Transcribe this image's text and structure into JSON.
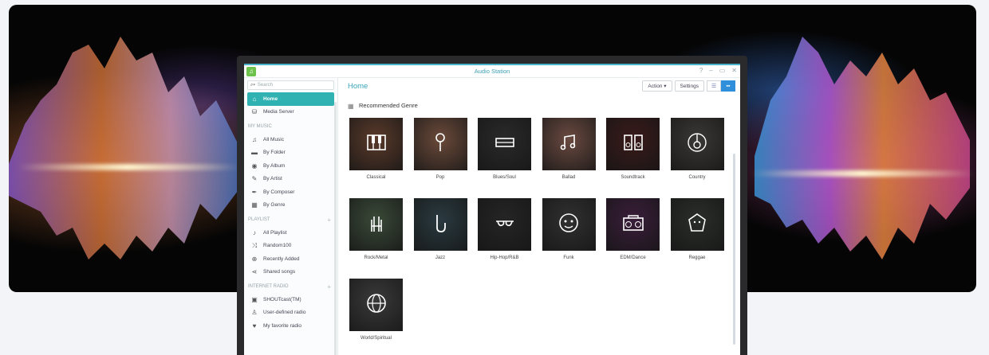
{
  "window": {
    "title": "Audio Station",
    "controls": [
      "?",
      "–",
      "▭",
      "✕"
    ]
  },
  "search": {
    "placeholder": "Search"
  },
  "sidebar": {
    "top_items": [
      {
        "label": "Home",
        "icon": "home-icon",
        "active": true
      },
      {
        "label": "Media Server",
        "icon": "media-server-icon",
        "active": false
      }
    ],
    "my_music": {
      "heading": "MY MUSIC",
      "items": [
        {
          "label": "All Music",
          "icon": "music-note-icon"
        },
        {
          "label": "By Folder",
          "icon": "folder-icon"
        },
        {
          "label": "By Album",
          "icon": "album-icon"
        },
        {
          "label": "By Artist",
          "icon": "microphone-icon"
        },
        {
          "label": "By Composer",
          "icon": "pen-icon"
        },
        {
          "label": "By Genre",
          "icon": "genre-grid-icon"
        }
      ]
    },
    "playlist": {
      "heading": "PLAYLIST",
      "items": [
        {
          "label": "All Playlist",
          "icon": "playlist-icon"
        },
        {
          "label": "Random100",
          "icon": "shuffle-icon"
        },
        {
          "label": "Recently Added",
          "icon": "plus-circle-icon"
        },
        {
          "label": "Shared songs",
          "icon": "share-icon"
        }
      ]
    },
    "internet_radio": {
      "heading": "INTERNET RADIO",
      "items": [
        {
          "label": "SHOUTcast(TM)",
          "icon": "radio-icon"
        },
        {
          "label": "User-defined radio",
          "icon": "user-icon"
        },
        {
          "label": "My favorite radio",
          "icon": "heart-icon"
        }
      ]
    }
  },
  "main": {
    "title": "Home",
    "toolbar": {
      "action_label": "Action ▾",
      "settings_label": "Settings"
    },
    "section_title": "Recommended Genre",
    "genres": [
      {
        "label": "Classical",
        "icon": "piano-keys-icon",
        "color": "#5a3a2a"
      },
      {
        "label": "Pop",
        "icon": "microphone-icon",
        "color": "#6b4a3a"
      },
      {
        "label": "Blues/Soul",
        "icon": "harmonica-icon",
        "color": "#2a2a2a"
      },
      {
        "label": "Ballad",
        "icon": "music-notes-icon",
        "color": "#6a4a40"
      },
      {
        "label": "Soundtrack",
        "icon": "speakers-icon",
        "color": "#3a1a1a"
      },
      {
        "label": "Country",
        "icon": "acoustic-guitar-icon",
        "color": "#3a3835"
      },
      {
        "label": "Rock/Metal",
        "icon": "rock-hand-icon",
        "color": "#3a4a38"
      },
      {
        "label": "Jazz",
        "icon": "saxophone-icon",
        "color": "#2a3a40"
      },
      {
        "label": "Hip-Hop/R&B",
        "icon": "sunglasses-icon",
        "color": "#252525"
      },
      {
        "label": "Funk",
        "icon": "funk-face-icon",
        "color": "#303030"
      },
      {
        "label": "EDM/Dance",
        "icon": "boombox-icon",
        "color": "#3a1e3a"
      },
      {
        "label": "Reggae",
        "icon": "lion-icon",
        "color": "#2a2e2a"
      },
      {
        "label": "World/Spiritual",
        "icon": "globe-icon",
        "color": "#3a3a3a"
      }
    ]
  }
}
